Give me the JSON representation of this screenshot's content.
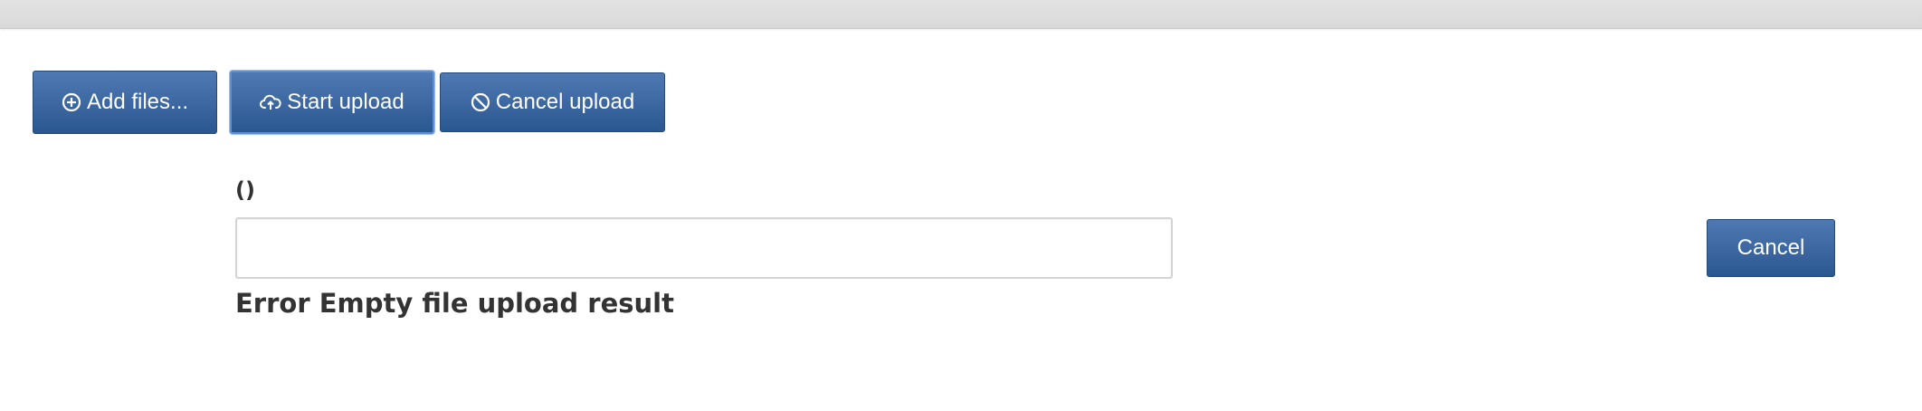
{
  "colors": {
    "button_top": "#4f79b3",
    "button_bottom": "#2b5791",
    "button_text": "#ffffff",
    "text": "#333333",
    "topbar": "#dcdcdc"
  },
  "toolbar": {
    "add_files": {
      "label": "Add files...",
      "icon": "plus-circle-icon"
    },
    "start_upload": {
      "label": "Start upload",
      "icon": "cloud-upload-icon"
    },
    "cancel_upload": {
      "label": "Cancel upload",
      "icon": "ban-icon"
    }
  },
  "file": {
    "name": "()",
    "progress": 0,
    "error": "Error Empty file upload result",
    "cancel_label": "Cancel"
  }
}
